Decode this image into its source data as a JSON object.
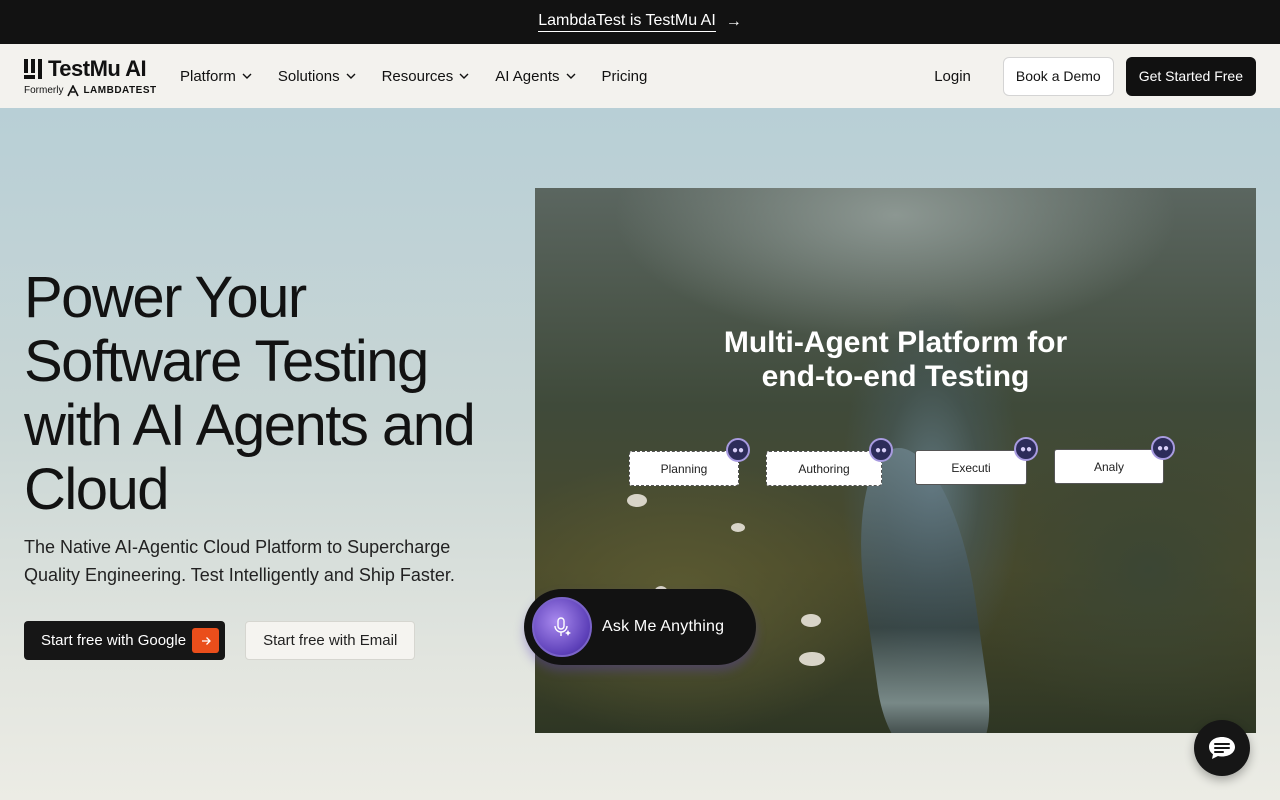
{
  "announcement": {
    "text": "LambdaTest is TestMu AI",
    "arrow": "→"
  },
  "nav": {
    "logo": {
      "brand": "TestMu AI",
      "formerly": "Formerly",
      "former_brand": "LAMBDATEST"
    },
    "menu": [
      {
        "label": "Platform",
        "has_dropdown": true
      },
      {
        "label": "Solutions",
        "has_dropdown": true
      },
      {
        "label": "Resources",
        "has_dropdown": true
      },
      {
        "label": "AI Agents",
        "has_dropdown": true
      },
      {
        "label": "Pricing",
        "has_dropdown": false
      }
    ],
    "login": "Login",
    "book_demo": "Book a Demo",
    "get_started": "Get Started Free"
  },
  "hero": {
    "title": "Power Your Software Testing with AI Agents and Cloud",
    "subtitle": "The Native AI-Agentic Cloud Platform to Supercharge Quality Engineering. Test Intelligently and Ship Faster.",
    "cta_google": "Start free with Google",
    "cta_email": "Start free with Email",
    "accent_color": "#ea4e1b"
  },
  "visual": {
    "headline_line1": "Multi-Agent Platform for",
    "headline_line2": "end-to-end Testing",
    "chips": [
      {
        "label": "Planning"
      },
      {
        "label": "Authoring"
      },
      {
        "label": "Executi"
      },
      {
        "label": "Analy"
      }
    ]
  },
  "assistant": {
    "label": "Ask Me Anything",
    "icon": "mic-sparkle-icon"
  },
  "chat": {
    "icon": "chat-bubble-icon"
  }
}
